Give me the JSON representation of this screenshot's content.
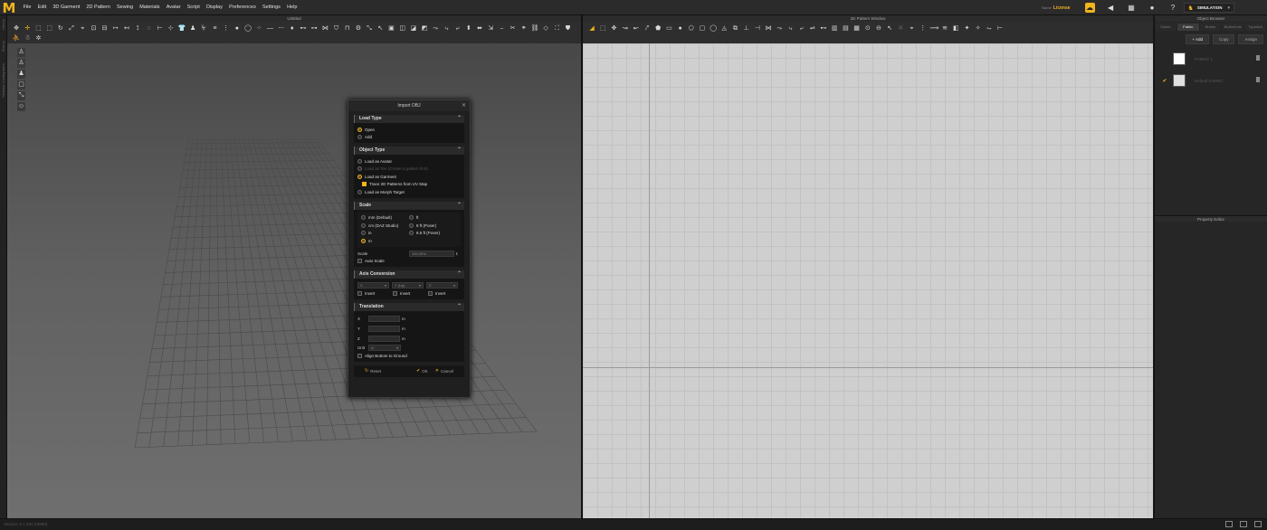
{
  "menu": [
    "File",
    "Edit",
    "3D Garment",
    "2D Pattern",
    "Sewing",
    "Materials",
    "Avatar",
    "Script",
    "Display",
    "Preferences",
    "Settings",
    "Help"
  ],
  "license": {
    "label": "Name",
    "value": "License"
  },
  "mode": "SIMULATION",
  "pane3d": {
    "title": "Untitled"
  },
  "pane2d": {
    "title": "2D Pattern Window"
  },
  "object_browser": {
    "title": "Object Browser",
    "tabs": [
      "Scene",
      "Fabric",
      "Button",
      "Buttonhole",
      "Topstitch"
    ],
    "active_tab": "Fabric",
    "buttons": [
      "+ Add",
      "Copy",
      "Assign"
    ],
    "fabrics": [
      {
        "name": "FABRIC 1",
        "checked": false
      },
      {
        "name": "Default FABRIC",
        "checked": true
      }
    ]
  },
  "property_editor": {
    "title": "Property Editor"
  },
  "left_tabs": [
    "Library",
    "History",
    "Modular Configurator"
  ],
  "status": {
    "version": "Version: 5.1.283 (r9899)"
  },
  "dialog": {
    "title": "Import OBJ",
    "load_type": {
      "title": "Load Type",
      "options": [
        "Open",
        "Add"
      ],
      "selected": "Open"
    },
    "object_type": {
      "title": "Object Type",
      "options": [
        "Load as Avatar",
        "Load as Tee (Create a pattern first)",
        "Load as Garment",
        "Load as Morph Target"
      ],
      "selected": "Load as Garment",
      "trace_label": "Trace 2D Patterns from UV Map",
      "trace_checked": true
    },
    "scale": {
      "title": "Scale",
      "units_left": [
        "mm (Default)",
        "cm (DAZ Studio)",
        "in",
        "m"
      ],
      "units_right": [
        "ft",
        "8 ft (Poser)",
        "8.6 ft (Poser)"
      ],
      "selected": "m",
      "scale_label": "Scale",
      "scale_value": "100.00%",
      "auto_label": "Auto Scale"
    },
    "axis": {
      "title": "Axis Conversion",
      "axes": [
        "X",
        "Y (Up)",
        "Z"
      ],
      "invert": "Invert"
    },
    "translation": {
      "title": "Translation",
      "rows": [
        {
          "axis": "X",
          "unit": "m"
        },
        {
          "axis": "Y",
          "unit": "m"
        },
        {
          "axis": "Z",
          "unit": "m"
        }
      ],
      "unit_label": "Unit",
      "unit_value": "m",
      "align_label": "Align Bottom to Ground"
    },
    "buttons": {
      "reset": "Reset",
      "ok": "OK",
      "cancel": "Cancel"
    }
  }
}
